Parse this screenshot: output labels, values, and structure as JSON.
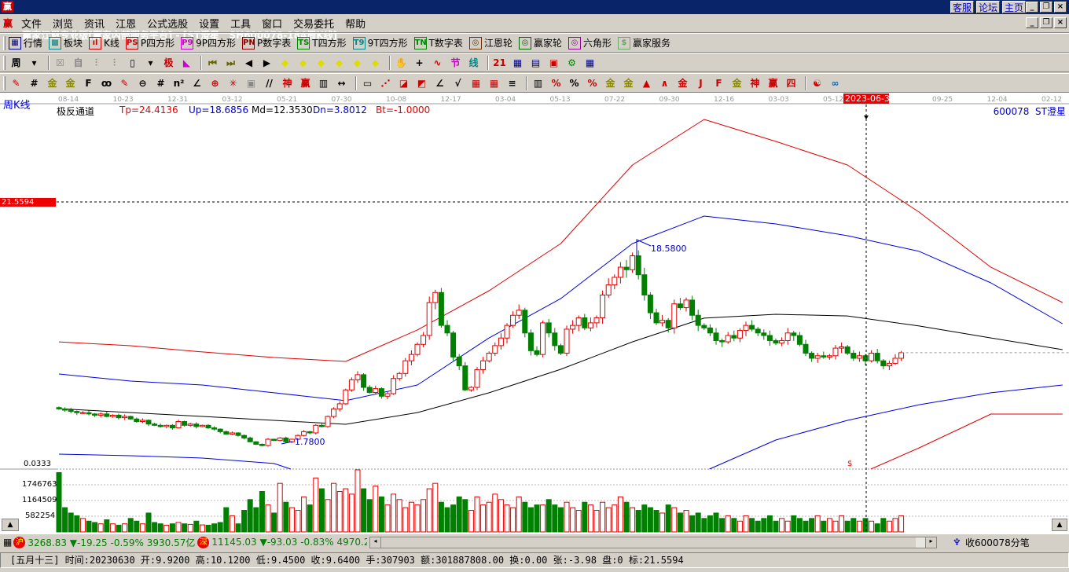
{
  "window": {
    "logo": "赢",
    "title": "赢家江恩专业版[赢家内部服务平台] - [ST澄星   SH600078-184周K线]",
    "links": [
      "客服",
      "论坛",
      "主页"
    ]
  },
  "menu": [
    "文件",
    "浏览",
    "资讯",
    "江恩",
    "公式选股",
    "设置",
    "工具",
    "窗口",
    "交易委托",
    "帮助"
  ],
  "toolbar1": [
    {
      "icon": "grid-icon",
      "badge": "▦",
      "color": "#00008b",
      "label": "行情"
    },
    {
      "icon": "blocks-icon",
      "badge": "▩",
      "color": "#008080",
      "label": "板块"
    },
    {
      "icon": "kline-icon",
      "badge": "ıl",
      "color": "#c00",
      "label": "K线"
    },
    {
      "icon": "ps-icon",
      "badge": "PS",
      "color": "#c00",
      "label": "P四方形"
    },
    {
      "icon": "p9-icon",
      "badge": "P9",
      "color": "#c0c",
      "label": "9P四方形"
    },
    {
      "icon": "pn-icon",
      "badge": "PN",
      "color": "#800",
      "label": "P数字表"
    },
    {
      "icon": "ts-icon",
      "badge": "TS",
      "color": "#080",
      "label": "T四方形"
    },
    {
      "icon": "t9-icon",
      "badge": "T9",
      "color": "#088",
      "label": "9T四方形"
    },
    {
      "icon": "tn-icon",
      "badge": "TN",
      "color": "#080",
      "label": "T数字表"
    },
    {
      "icon": "gann-wheel-icon",
      "badge": "◎",
      "color": "#630",
      "label": "江恩轮"
    },
    {
      "icon": "yingjia-wheel-icon",
      "badge": "◎",
      "color": "#060",
      "label": "赢家轮"
    },
    {
      "icon": "hexagon-icon",
      "badge": "◎",
      "color": "#909",
      "label": "六角形"
    },
    {
      "icon": "dollar-icon",
      "badge": "$",
      "color": "#6a6",
      "label": "赢家服务"
    }
  ],
  "toolbar2": {
    "period": "周",
    "icons": [
      [
        "week-period-icon",
        "周",
        "#000"
      ],
      [
        "dropdown-icon",
        "▾",
        "#000"
      ],
      [
        "sep"
      ],
      [
        "pattern-icon",
        "☒",
        "#888"
      ],
      [
        "self-icon",
        "自",
        "#888"
      ],
      [
        "bars-icon",
        "⫶",
        "#888"
      ],
      [
        "bars2-icon",
        "⫶",
        "#888"
      ],
      [
        "candle-icon",
        "▯",
        "#000"
      ],
      [
        "dropdown-icon",
        "▾",
        "#000"
      ],
      [
        "ji-icon",
        "极",
        "#c00"
      ],
      [
        "triangle-chart-icon",
        "◣",
        "#c0c"
      ],
      [
        "sep"
      ],
      [
        "first-icon",
        "⏮",
        "#660"
      ],
      [
        "last-icon",
        "⏭",
        "#660"
      ],
      [
        "left-icon",
        "◀",
        "#000"
      ],
      [
        "right-icon",
        "▶",
        "#000"
      ],
      [
        "diamond-left-icon",
        "◆",
        "#dd0"
      ],
      [
        "diamond-right-icon",
        "◆",
        "#dd0"
      ],
      [
        "diamond-lr-icon",
        "◆",
        "#dd0"
      ],
      [
        "diamond-x-icon",
        "◆",
        "#dd0"
      ],
      [
        "diamond-star-icon",
        "◆",
        "#dd0"
      ],
      [
        "diamond-all-icon",
        "◆",
        "#dd0"
      ],
      [
        "sep"
      ],
      [
        "hand-icon",
        "✋",
        "#000"
      ],
      [
        "crosshair-icon",
        "+",
        "#000"
      ],
      [
        "line-icon",
        "∿",
        "#c00"
      ],
      [
        "jie-icon",
        "节",
        "#c0c"
      ],
      [
        "xian-icon",
        "线",
        "#088"
      ],
      [
        "sep"
      ],
      [
        "calendar-icon",
        "21",
        "#c00"
      ],
      [
        "calculator-icon",
        "▦",
        "#008"
      ],
      [
        "notes-icon",
        "▤",
        "#008"
      ],
      [
        "save-icon",
        "▣",
        "#c00"
      ],
      [
        "network-icon",
        "⚙",
        "#080"
      ],
      [
        "print-icon",
        "▦",
        "#008"
      ]
    ]
  },
  "toolbar3": [
    [
      "pen-icon",
      "✎",
      "#c00"
    ],
    [
      "hash-icon",
      "#",
      "#000"
    ],
    [
      "gold1-icon",
      "金",
      "#880"
    ],
    [
      "gold2-icon",
      "金",
      "#880"
    ],
    [
      "f-icon",
      "F",
      "#000"
    ],
    [
      "spiral-icon",
      "ꝏ",
      "#000"
    ],
    [
      "pen2-icon",
      "✎",
      "#c00"
    ],
    [
      "circle-icon",
      "⊖",
      "#000"
    ],
    [
      "hash2-icon",
      "#",
      "#000"
    ],
    [
      "n2-icon",
      "n²",
      "#000"
    ],
    [
      "angle-icon",
      "∠",
      "#000"
    ],
    [
      "target-icon",
      "⊕",
      "#c00"
    ],
    [
      "star-icon",
      "✳",
      "#c00"
    ],
    [
      "box-icon",
      "▣",
      "#888"
    ],
    [
      "slash-icon",
      "//",
      "#000"
    ],
    [
      "shen-icon",
      "神",
      "#c00"
    ],
    [
      "ying-icon",
      "赢",
      "#c00"
    ],
    [
      "grid-icon",
      "▥",
      "#000"
    ],
    [
      "arrows-icon",
      "↔",
      "#000"
    ],
    [
      "sep"
    ],
    [
      "rect-icon",
      "▭",
      "#000"
    ],
    [
      "fan-icon",
      "⋰",
      "#c00"
    ],
    [
      "fan2-icon",
      "◪",
      "#c00"
    ],
    [
      "fan3-icon",
      "◩",
      "#c00"
    ],
    [
      "angle2-icon",
      "∠",
      "#000"
    ],
    [
      "v-icon",
      "√",
      "#000"
    ],
    [
      "grid2-icon",
      "▦",
      "#c00"
    ],
    [
      "grid3-icon",
      "▦",
      "#c00"
    ],
    [
      "lines-icon",
      "≡",
      "#000"
    ],
    [
      "sep"
    ],
    [
      "table-icon",
      "▥",
      "#000"
    ],
    [
      "pct-icon",
      "%",
      "#c00"
    ],
    [
      "pct2-icon",
      "%",
      "#000"
    ],
    [
      "pct3-icon",
      "%",
      "#c00"
    ],
    [
      "coin-icon",
      "金",
      "#880"
    ],
    [
      "gold3-icon",
      "金",
      "#880"
    ],
    [
      "drop-icon",
      "▲",
      "#c00"
    ],
    [
      "wave-icon",
      "∧",
      "#c00"
    ],
    [
      "gold4-icon",
      "金",
      "#c00"
    ],
    [
      "j-icon",
      "J",
      "#c00"
    ],
    [
      "f2-icon",
      "F",
      "#c00"
    ],
    [
      "gold5-icon",
      "金",
      "#880"
    ],
    [
      "shen2-icon",
      "神",
      "#c00"
    ],
    [
      "ying2-icon",
      "赢",
      "#c00"
    ],
    [
      "si-icon",
      "四",
      "#c00"
    ],
    [
      "sep"
    ],
    [
      "yinyang-icon",
      "☯",
      "#c00"
    ],
    [
      "infinity-icon",
      "∞",
      "#06c"
    ]
  ],
  "chart": {
    "period_label": "周K线",
    "dates": [
      "08-14",
      "10-23",
      "12-31",
      "03-12",
      "05-21",
      "07-30",
      "10-08",
      "12-17",
      "03-04",
      "05-13",
      "07-22",
      "09-30",
      "12-16",
      "03-03",
      "05-12",
      "2023-06-30",
      "09-25",
      "12-04",
      "02-12"
    ],
    "indicator": {
      "name": "极反通道",
      "tp": "Tp=24.4136",
      "up": "Up=18.6856",
      "md": "Md=12.3530",
      "dn": "Dn=3.8012",
      "bt": "Bt=-1.0000"
    },
    "stock_label": "600078  ST澄星",
    "cursor_price": "21.5594",
    "high_label": "18.5800",
    "low_label": "1.7800",
    "axis_min": "0.0333",
    "dollar": "$",
    "volume_ticks": [
      "1746763",
      "1164509",
      "582254"
    ],
    "colors": {
      "up": "#e00000",
      "down": "#008000",
      "tp": "#e00000",
      "upline": "#0000e0",
      "mid": "#000000"
    }
  },
  "chart_data": {
    "type": "candlestick",
    "title": "SH600078 周K线",
    "closes": [
      5.2,
      5.1,
      5.0,
      4.9,
      4.9,
      4.8,
      4.7,
      4.8,
      4.6,
      4.7,
      4.5,
      4.6,
      4.4,
      4.2,
      4.3,
      4.0,
      3.9,
      3.8,
      3.9,
      3.7,
      4.2,
      3.9,
      4.0,
      3.8,
      3.9,
      3.7,
      3.6,
      3.4,
      3.2,
      3.3,
      3.1,
      2.9,
      2.6,
      2.4,
      2.3,
      2.8,
      2.7,
      2.9,
      2.6,
      2.8,
      3.1,
      3.4,
      3.3,
      3.9,
      3.8,
      4.6,
      5.2,
      5.6,
      6.7,
      7.5,
      7.9,
      6.9,
      6.5,
      6.8,
      6.2,
      6.4,
      7.6,
      8.0,
      9.0,
      9.5,
      10.3,
      11.0,
      13.6,
      14.4,
      11.8,
      11.2,
      9.3,
      8.6,
      6.7,
      6.9,
      8.3,
      9.0,
      9.6,
      10.2,
      10.8,
      11.8,
      12.6,
      13.0,
      11.2,
      9.8,
      9.5,
      12.0,
      11.2,
      10.2,
      9.6,
      11.5,
      11.8,
      12.4,
      11.6,
      12.0,
      12.4,
      14.2,
      15.0,
      15.6,
      16.4,
      16.2,
      17.3,
      15.8,
      14.2,
      12.8,
      12.0,
      12.2,
      11.6,
      13.5,
      13.2,
      13.8,
      12.6,
      11.8,
      11.6,
      11.2,
      10.6,
      10.5,
      11.0,
      10.8,
      11.4,
      11.8,
      11.5,
      11.2,
      11.0,
      10.6,
      10.4,
      10.6,
      11.2,
      11.0,
      10.3,
      9.6,
      9.2,
      9.4,
      9.3,
      9.4,
      10.0,
      10.1,
      9.6,
      9.2,
      9.4,
      9.0,
      9.6,
      9.0,
      8.6,
      8.8,
      9.2,
      9.64
    ],
    "volumes_k": [
      2200,
      900,
      700,
      600,
      500,
      400,
      350,
      300,
      450,
      300,
      250,
      300,
      500,
      400,
      300,
      700,
      350,
      300,
      250,
      300,
      350,
      300,
      280,
      400,
      260,
      250,
      300,
      350,
      900,
      600,
      300,
      800,
      1200,
      900,
      1500,
      1000,
      700,
      1800,
      1100,
      900,
      800,
      1300,
      1000,
      2000,
      1600,
      1200,
      1800,
      1500,
      1600,
      1400,
      2300,
      1600,
      1200,
      1700,
      1300,
      1000,
      1400,
      1200,
      900,
      1100,
      1000,
      1200,
      1600,
      1800,
      1100,
      900,
      1000,
      1300,
      1200,
      800,
      1300,
      1000,
      1100,
      1400,
      1200,
      1000,
      900,
      1300,
      1100,
      900,
      1000,
      1000,
      1200,
      1000,
      900,
      1100,
      900,
      800,
      1100,
      1000,
      800,
      1100,
      900,
      1000,
      1300,
      1100,
      900,
      800,
      1000,
      900,
      800,
      700,
      1000,
      900,
      700,
      800,
      600,
      700,
      500,
      600,
      700,
      500,
      600,
      500,
      400,
      600,
      500,
      400,
      500,
      600,
      400,
      500,
      400,
      600,
      500,
      400,
      500,
      600,
      400,
      500,
      400,
      600,
      400,
      500,
      400,
      500,
      400,
      300,
      500,
      400,
      500,
      600
    ],
    "channel_step_weeks": 12,
    "channels": {
      "tp": [
        10.5,
        10.19,
        9.7,
        9.26,
        8.95,
        11.44,
        14.54,
        18.27,
        24.48,
        28.08,
        26.34,
        24.48,
        20.75,
        16.4,
        13.61
      ],
      "up": [
        7.96,
        7.4,
        7.09,
        6.47,
        5.85,
        7.09,
        10.81,
        13.92,
        18.27,
        20.44,
        19.82,
        18.89,
        17.65,
        15.16,
        11.93
      ],
      "md": [
        5.22,
        4.91,
        4.6,
        4.29,
        3.98,
        4.91,
        6.47,
        8.33,
        10.5,
        12.37,
        12.68,
        12.55,
        11.75,
        10.81,
        9.88
      ],
      "dn": [
        1.62,
        1.5,
        1.31,
        0.88,
        -0.99,
        -3.47,
        -4.71,
        -4.71,
        -3.47,
        0.26,
        2.74,
        4.29,
        5.53,
        6.47,
        7.09
      ],
      "bt": [
        -12,
        -12,
        -12,
        -12,
        -12,
        -12,
        -12,
        -12,
        -12,
        -10,
        -6,
        -0.37,
        2.12,
        4.79,
        4.79
      ]
    },
    "ylim": [
      0.0333,
      28.5
    ]
  },
  "bottom": {
    "sh_badge": "沪",
    "sh": "3268.83 ▼-19.25 -0.59% 3930.57亿",
    "sz_badge": "深",
    "sz": "11145.03 ▼-93.03 -0.83% 4970.2",
    "receive": "收600078分笔"
  },
  "status": "[五月十三] 时间:20230630 开:9.9200 高:10.1200 低:9.4500 收:9.6400 手:307903 额:301887808.00 换:0.00 张:-3.98 盘:0 标:21.5594"
}
